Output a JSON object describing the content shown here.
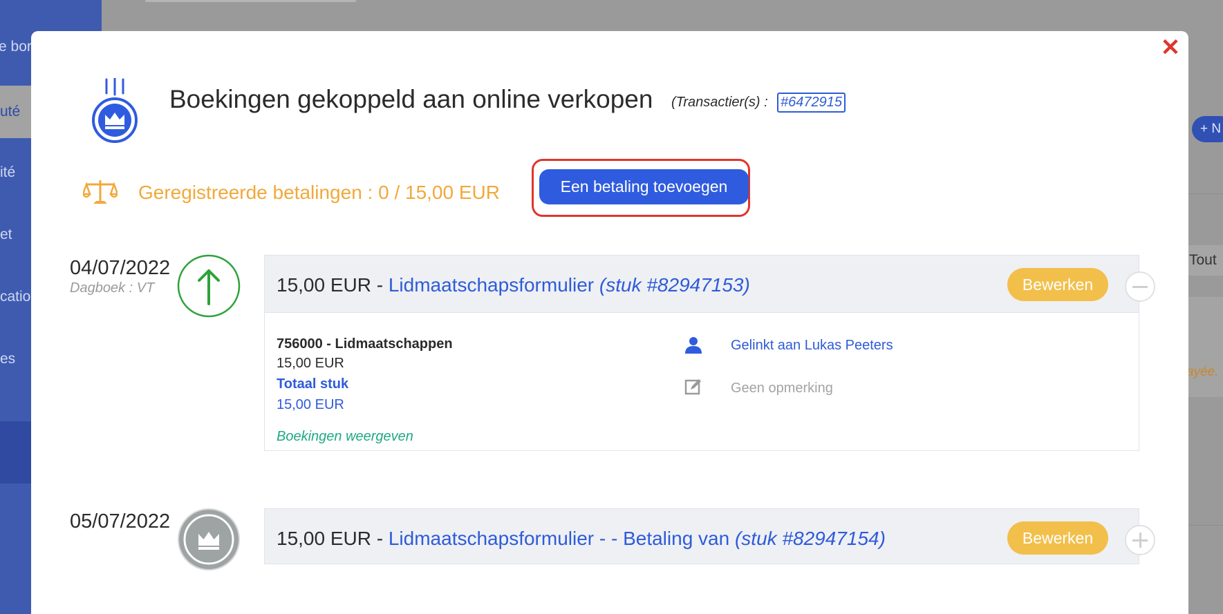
{
  "background": {
    "sidebar_items": [
      "e bor",
      "uté",
      "ité",
      "et",
      "cation",
      "es"
    ],
    "new_button": "+ N",
    "tout_label": "Tout",
    "payee_text": "ayée."
  },
  "modal": {
    "close_label": "✕",
    "title": "Boekingen gekoppeld aan online verkopen",
    "transactions_label": "(Transactier(s) :",
    "transaction_link": "#6472915",
    "payments_label": "Geregistreerde betalingen : 0 / 15,00 EUR",
    "add_payment_button": "Een betaling toevoegen",
    "entries": [
      {
        "date": "04/07/2022",
        "journal": "Dagboek : VT",
        "amount": "15,00 EUR",
        "separator": " - ",
        "document": "Lidmaatschapsformulier",
        "piece": "(stuk #82947153)",
        "edit_button": "Bewerken",
        "status_icon": "arrow-up-icon",
        "expanded": true,
        "account": "756000 - Lidmaatschappen",
        "account_amount": "15,00 EUR",
        "total_label": "Totaal stuk",
        "total_amount": "15,00 EUR",
        "show_bookings": "Boekingen weergeven",
        "linked_to": "Gelinkt aan Lukas Peeters",
        "note": "Geen opmerking"
      },
      {
        "date": "05/07/2022",
        "amount": "15,00 EUR",
        "separator": " - ",
        "document": "Lidmaatschapsformulier - - Betaling van",
        "piece": "(stuk #82947154)",
        "edit_button": "Bewerken",
        "status_icon": "crown-icon",
        "expanded": false
      }
    ]
  },
  "colors": {
    "primary": "#2f5bdf",
    "warning": "#f2bf4b",
    "payments": "#f0a93a",
    "success": "#21a884",
    "close": "#e0352b"
  }
}
